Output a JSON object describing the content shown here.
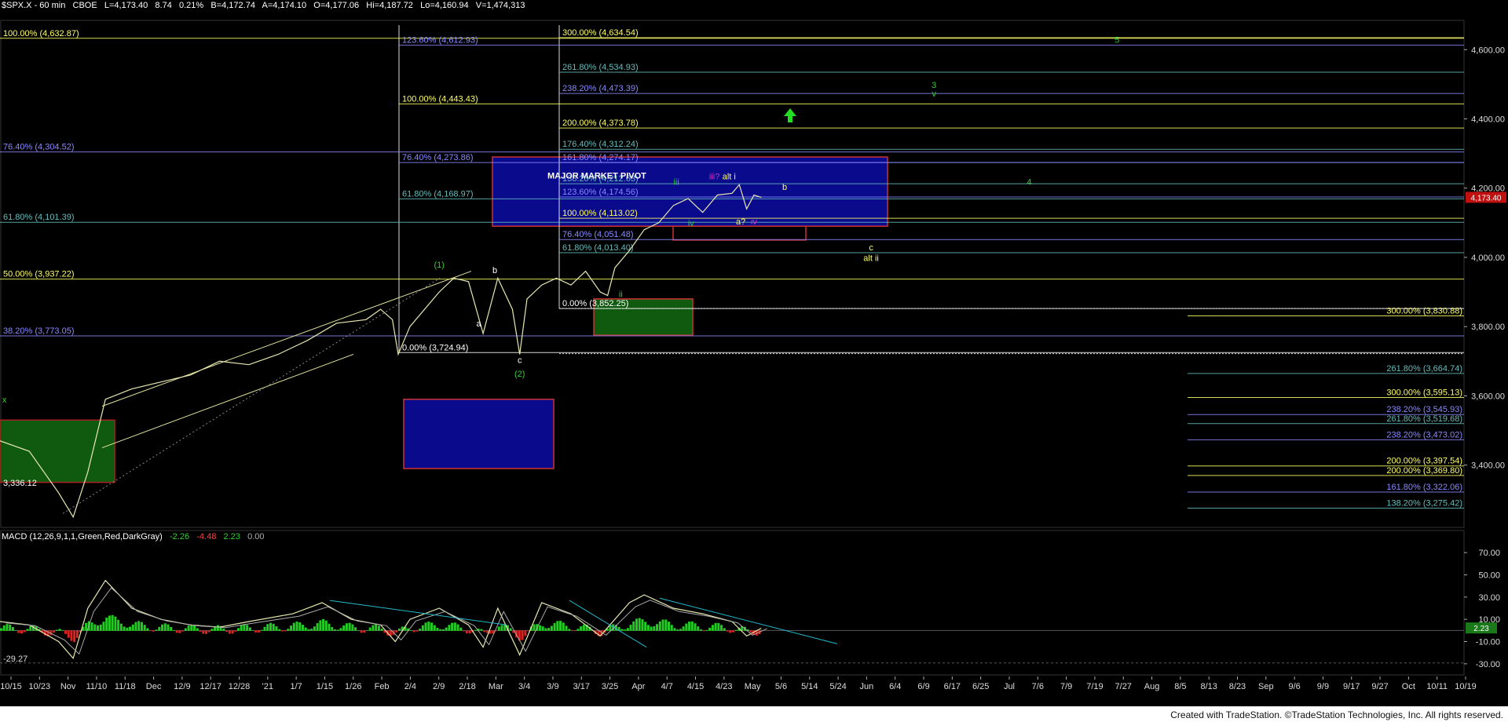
{
  "header": {
    "symbol": "$SPX.X - 60 min",
    "exchange": "CBOE",
    "last": "L=4,173.40",
    "change": "8.74",
    "change_pct": "0.21%",
    "bid": "B=4,172.74",
    "ask": "A=4,174.10",
    "open": "O=4,177.06",
    "high": "Hi=4,187.72",
    "low": "Lo=4,160.94",
    "volume": "V=1,474,313"
  },
  "macd_header": {
    "label": "MACD (12,26,9,1,1,Green,Red,DarkGray)",
    "v1": "-2.26",
    "v2": "-4.48",
    "v3": "2.23",
    "v4": "0.00"
  },
  "footer": "Created with TradeStation. ©TradeStation Technologies, Inc. All rights reserved.",
  "chart_data": {
    "type": "line",
    "price_axis": {
      "ticks": [
        3400,
        3600,
        3800,
        4000,
        4200,
        4400,
        4600
      ],
      "labels": [
        "3,400.00",
        "3,600.00",
        "3,800.00",
        "4,000.00",
        "4,200.00",
        "4,400.00",
        "4,600.00"
      ],
      "range": [
        3220,
        4680
      ],
      "last_label": "4,173.40"
    },
    "macd_axis": {
      "ticks": [
        70,
        50,
        30,
        10,
        -10,
        -30
      ],
      "labels": [
        "70.00",
        "50.00",
        "30.00",
        "10.00",
        "-10.00",
        "-30.00"
      ],
      "range": [
        -40,
        80
      ],
      "current_label": "2.23",
      "low_label": "-29.27"
    },
    "x_axis": [
      "10/15",
      "10/23",
      "Nov",
      "11/10",
      "11/18",
      "Dec",
      "12/9",
      "12/17",
      "12/28",
      "'21",
      "1/7",
      "1/15",
      "1/26",
      "Feb",
      "2/4",
      "2/9",
      "2/18",
      "Mar",
      "3/4",
      "3/9",
      "3/17",
      "3/25",
      "Apr",
      "4/7",
      "4/15",
      "4/23",
      "May",
      "5/6",
      "5/14",
      "5/24",
      "Jun",
      "6/4",
      "6/9",
      "6/17",
      "6/25",
      "Jul",
      "7/6",
      "7/9",
      "7/19",
      "7/27",
      "Aug",
      "8/5",
      "8/13",
      "8/23",
      "Sep",
      "9/6",
      "9/9",
      "9/17",
      "9/27",
      "Oct",
      "10/11",
      "10/19"
    ],
    "price_path": [
      [
        0,
        3470
      ],
      [
        0.02,
        3440
      ],
      [
        0.04,
        3320
      ],
      [
        0.05,
        3250
      ],
      [
        0.06,
        3380
      ],
      [
        0.072,
        3590
      ],
      [
        0.09,
        3620
      ],
      [
        0.11,
        3640
      ],
      [
        0.13,
        3660
      ],
      [
        0.15,
        3700
      ],
      [
        0.17,
        3690
      ],
      [
        0.19,
        3720
      ],
      [
        0.21,
        3760
      ],
      [
        0.23,
        3810
      ],
      [
        0.25,
        3820
      ],
      [
        0.26,
        3850
      ],
      [
        0.268,
        3820
      ],
      [
        0.272,
        3720
      ],
      [
        0.28,
        3800
      ],
      [
        0.3,
        3900
      ],
      [
        0.31,
        3940
      ],
      [
        0.32,
        3930
      ],
      [
        0.33,
        3780
      ],
      [
        0.34,
        3940
      ],
      [
        0.35,
        3850
      ],
      [
        0.355,
        3720
      ],
      [
        0.36,
        3880
      ],
      [
        0.37,
        3920
      ],
      [
        0.38,
        3940
      ],
      [
        0.39,
        3920
      ],
      [
        0.4,
        3960
      ],
      [
        0.41,
        3900
      ],
      [
        0.415,
        3890
      ],
      [
        0.42,
        3970
      ],
      [
        0.43,
        4020
      ],
      [
        0.44,
        4080
      ],
      [
        0.45,
        4100
      ],
      [
        0.46,
        4150
      ],
      [
        0.47,
        4170
      ],
      [
        0.48,
        4130
      ],
      [
        0.49,
        4180
      ],
      [
        0.5,
        4185
      ],
      [
        0.505,
        4210
      ],
      [
        0.51,
        4140
      ],
      [
        0.515,
        4180
      ],
      [
        0.52,
        4173
      ]
    ],
    "macd_path": [
      [
        0,
        8
      ],
      [
        0.02,
        5
      ],
      [
        0.04,
        -10
      ],
      [
        0.05,
        -25
      ],
      [
        0.06,
        20
      ],
      [
        0.072,
        45
      ],
      [
        0.09,
        20
      ],
      [
        0.11,
        10
      ],
      [
        0.13,
        5
      ],
      [
        0.15,
        3
      ],
      [
        0.17,
        8
      ],
      [
        0.2,
        15
      ],
      [
        0.22,
        25
      ],
      [
        0.24,
        10
      ],
      [
        0.26,
        5
      ],
      [
        0.27,
        -10
      ],
      [
        0.28,
        10
      ],
      [
        0.3,
        20
      ],
      [
        0.32,
        5
      ],
      [
        0.33,
        -15
      ],
      [
        0.34,
        20
      ],
      [
        0.355,
        -22
      ],
      [
        0.37,
        25
      ],
      [
        0.39,
        15
      ],
      [
        0.41,
        -5
      ],
      [
        0.43,
        25
      ],
      [
        0.44,
        32
      ],
      [
        0.46,
        20
      ],
      [
        0.48,
        15
      ],
      [
        0.5,
        8
      ],
      [
        0.51,
        -5
      ],
      [
        0.52,
        2
      ]
    ],
    "fib_levels": [
      {
        "label": "100.00% (4,632.87)",
        "price": 4632.87,
        "color": "#ffff66",
        "side": "left"
      },
      {
        "label": "76.40% (4,304.52)",
        "price": 4304.52,
        "color": "#8a8aff",
        "side": "left"
      },
      {
        "label": "61.80% (4,101.39)",
        "price": 4101.39,
        "color": "#66bbbb",
        "side": "left"
      },
      {
        "label": "50.00% (3,937.22)",
        "price": 3937.22,
        "color": "#ffff66",
        "side": "left"
      },
      {
        "label": "38.20% (3,773.05)",
        "price": 3773.05,
        "color": "#8a8aff",
        "side": "left"
      },
      {
        "label": "123.60% (4,612.93)",
        "price": 4612.93,
        "color": "#8a8aff",
        "side": "mid1"
      },
      {
        "label": "100.00% (4,443.43)",
        "price": 4443.43,
        "color": "#ffff66",
        "side": "mid1"
      },
      {
        "label": "76.40% (4,273.86)",
        "price": 4273.86,
        "color": "#8a8aff",
        "side": "mid1"
      },
      {
        "label": "61.80% (4,168.97)",
        "price": 4168.97,
        "color": "#66bbbb",
        "side": "mid1"
      },
      {
        "label": "0.00% (3,724.94)",
        "price": 3724.94,
        "color": "#ffffff",
        "side": "mid1"
      },
      {
        "label": "300.00% (4,634.54)",
        "price": 4634.54,
        "color": "#ffff66",
        "side": "mid2"
      },
      {
        "label": "261.80% (4,534.93)",
        "price": 4534.93,
        "color": "#66bbbb",
        "side": "mid2"
      },
      {
        "label": "238.20% (4,473.39)",
        "price": 4473.39,
        "color": "#8a8aff",
        "side": "mid2"
      },
      {
        "label": "200.00% (4,373.78)",
        "price": 4373.78,
        "color": "#ffff66",
        "side": "mid2"
      },
      {
        "label": "176.40% (4,312.24)",
        "price": 4312.24,
        "color": "#66bbbb",
        "side": "mid2"
      },
      {
        "label": "161.80% (4,274.17)",
        "price": 4274.17,
        "color": "#8a8aff",
        "side": "mid2"
      },
      {
        "label": "138.20% (4,212.63)",
        "price": 4212.63,
        "color": "#66bbbb",
        "side": "mid2"
      },
      {
        "label": "123.60% (4,174.56)",
        "price": 4174.56,
        "color": "#8a8aff",
        "side": "mid2"
      },
      {
        "label": "100.00% (4,113.02)",
        "price": 4113.02,
        "color": "#ffff66",
        "side": "mid2"
      },
      {
        "label": "76.40% (4,051.48)",
        "price": 4051.48,
        "color": "#8a8aff",
        "side": "mid2"
      },
      {
        "label": "61.80% (4,013.40)",
        "price": 4013.4,
        "color": "#66bbbb",
        "side": "mid2"
      },
      {
        "label": "0.00% (3,852.25)",
        "price": 3852.25,
        "color": "#ffffff",
        "side": "mid2"
      },
      {
        "label": "300.00% (3,830.88)",
        "price": 3830.88,
        "color": "#ffff66",
        "side": "right"
      },
      {
        "label": "261.80% (3,664.74)",
        "price": 3664.74,
        "color": "#66bbbb",
        "side": "right"
      },
      {
        "label": "300.00% (3,595.13)",
        "price": 3595.13,
        "color": "#ffff66",
        "side": "right"
      },
      {
        "label": "238.20% (3,545.93)",
        "price": 3545.93,
        "color": "#8a8aff",
        "side": "right"
      },
      {
        "label": "261.80% (3,519.68)",
        "price": 3519.68,
        "color": "#66bbbb",
        "side": "right"
      },
      {
        "label": "238.20% (3,473.02)",
        "price": 3473.02,
        "color": "#8a8aff",
        "side": "right"
      },
      {
        "label": "200.00% (3,397.54)",
        "price": 3397.54,
        "color": "#ffff66",
        "side": "right"
      },
      {
        "label": "200.00% (3,369.80)",
        "price": 3369.8,
        "color": "#ffff66",
        "side": "right"
      },
      {
        "label": "161.80% (3,322.06)",
        "price": 3322.06,
        "color": "#8a8aff",
        "side": "right"
      },
      {
        "label": "138.20% (3,275.42)",
        "price": 3275.42,
        "color": "#66bbbb",
        "side": "right"
      }
    ],
    "misc_labels": [
      {
        "text": "3,336.12",
        "color": "#ffffff"
      },
      {
        "text": "MAJOR MARKET PIVOT",
        "color": "#ffffff"
      }
    ],
    "wave_labels": [
      {
        "text": "(1)",
        "color": "#33cc33",
        "x": 0.3,
        "price": 3970
      },
      {
        "text": "b",
        "color": "#ffffff",
        "x": 0.338,
        "price": 3955
      },
      {
        "text": "a",
        "color": "#ffffff",
        "x": 0.327,
        "price": 3800
      },
      {
        "text": "c",
        "color": "#ffffff",
        "x": 0.355,
        "price": 3695
      },
      {
        "text": "(2)",
        "color": "#33cc33",
        "x": 0.355,
        "price": 3655
      },
      {
        "text": "ii",
        "color": "#33cc33",
        "x": 0.424,
        "price": 3885
      },
      {
        "text": "iii",
        "color": "#33cc33",
        "x": 0.462,
        "price": 4210
      },
      {
        "text": "iv",
        "color": "#33cc33",
        "x": 0.472,
        "price": 4090
      },
      {
        "text": "iii?",
        "color": "#cc33cc",
        "x": 0.488,
        "price": 4225
      },
      {
        "text": "alt i",
        "color": "#ffff66",
        "x": 0.498,
        "price": 4225
      },
      {
        "text": "a?",
        "color": "#ffff66",
        "x": 0.506,
        "price": 4095
      },
      {
        "text": "iv",
        "color": "#cc33cc",
        "x": 0.515,
        "price": 4095
      },
      {
        "text": "b",
        "color": "#ffff66",
        "x": 0.536,
        "price": 4195
      },
      {
        "text": "c",
        "color": "#ffff66",
        "x": 0.595,
        "price": 4020
      },
      {
        "text": "alt ii",
        "color": "#ffff66",
        "x": 0.595,
        "price": 3990
      },
      {
        "text": "3",
        "color": "#33cc33",
        "x": 0.638,
        "price": 4490
      },
      {
        "text": "v",
        "color": "#33cc33",
        "x": 0.638,
        "price": 4465
      },
      {
        "text": "4",
        "color": "#33cc33",
        "x": 0.703,
        "price": 4210
      },
      {
        "text": "5",
        "color": "#33cc33",
        "x": 0.763,
        "price": 4620
      },
      {
        "text": "x",
        "color": "#33cc33",
        "x": 0.003,
        "price": 3580
      }
    ]
  }
}
